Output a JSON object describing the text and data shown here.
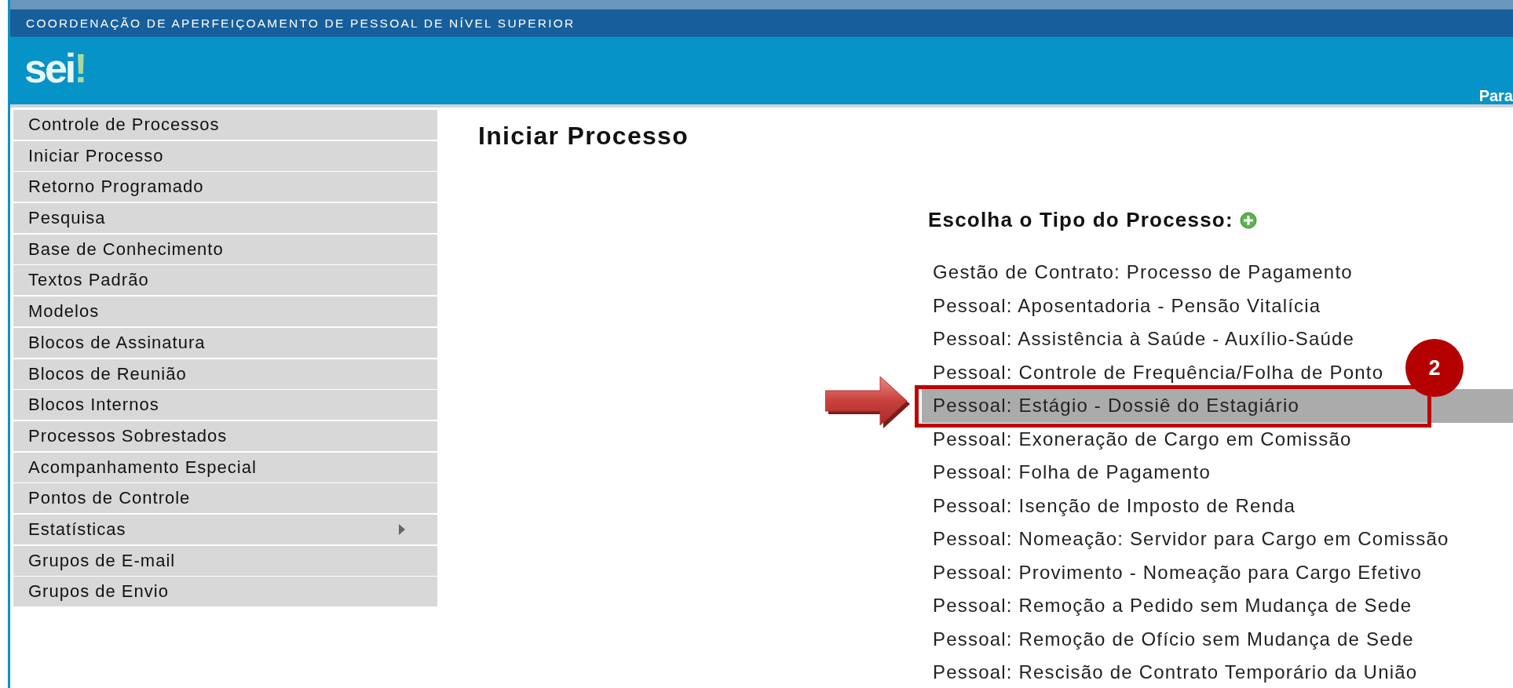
{
  "header": {
    "organization": "COORDENAÇÃO DE APERFEIÇOAMENTO DE PESSOAL DE NÍVEL SUPERIOR",
    "logo": "sei",
    "logo_mark": "!",
    "right_text": "Para"
  },
  "sidebar": {
    "items": [
      {
        "label": "Controle de Processos",
        "has_submenu": false
      },
      {
        "label": "Iniciar Processo",
        "has_submenu": false
      },
      {
        "label": "Retorno Programado",
        "has_submenu": false
      },
      {
        "label": "Pesquisa",
        "has_submenu": false
      },
      {
        "label": "Base de Conhecimento",
        "has_submenu": false
      },
      {
        "label": "Textos Padrão",
        "has_submenu": false
      },
      {
        "label": "Modelos",
        "has_submenu": false
      },
      {
        "label": "Blocos de Assinatura",
        "has_submenu": false
      },
      {
        "label": "Blocos de Reunião",
        "has_submenu": false
      },
      {
        "label": "Blocos Internos",
        "has_submenu": false
      },
      {
        "label": "Processos Sobrestados",
        "has_submenu": false
      },
      {
        "label": "Acompanhamento Especial",
        "has_submenu": false
      },
      {
        "label": "Pontos de Controle",
        "has_submenu": false
      },
      {
        "label": "Estatísticas",
        "has_submenu": true
      },
      {
        "label": "Grupos de E-mail",
        "has_submenu": false
      },
      {
        "label": "Grupos de Envio",
        "has_submenu": false
      }
    ]
  },
  "main": {
    "title": "Iniciar Processo",
    "list_title": "Escolha o Tipo do Processo:",
    "process_types": [
      {
        "label": "Gestão de Contrato: Processo de Pagamento",
        "selected": false
      },
      {
        "label": "Pessoal: Aposentadoria - Pensão Vitalícia",
        "selected": false
      },
      {
        "label": "Pessoal: Assistência à Saúde - Auxílio-Saúde",
        "selected": false
      },
      {
        "label": "Pessoal: Controle de Frequência/Folha de Ponto",
        "selected": false
      },
      {
        "label": "Pessoal: Estágio - Dossiê do Estagiário",
        "selected": true
      },
      {
        "label": "Pessoal: Exoneração de Cargo em Comissão",
        "selected": false
      },
      {
        "label": "Pessoal: Folha de Pagamento",
        "selected": false
      },
      {
        "label": "Pessoal: Isenção de Imposto de Renda",
        "selected": false
      },
      {
        "label": "Pessoal: Nomeação: Servidor para Cargo em Comissão",
        "selected": false
      },
      {
        "label": "Pessoal: Provimento - Nomeação para Cargo Efetivo",
        "selected": false
      },
      {
        "label": "Pessoal: Remoção a Pedido sem Mudança de Sede",
        "selected": false
      },
      {
        "label": "Pessoal: Remoção de Ofício sem Mudança de Sede",
        "selected": false
      },
      {
        "label": "Pessoal: Rescisão de Contrato Temporário da União",
        "selected": false
      }
    ],
    "annotation": {
      "badge": "2"
    }
  }
}
